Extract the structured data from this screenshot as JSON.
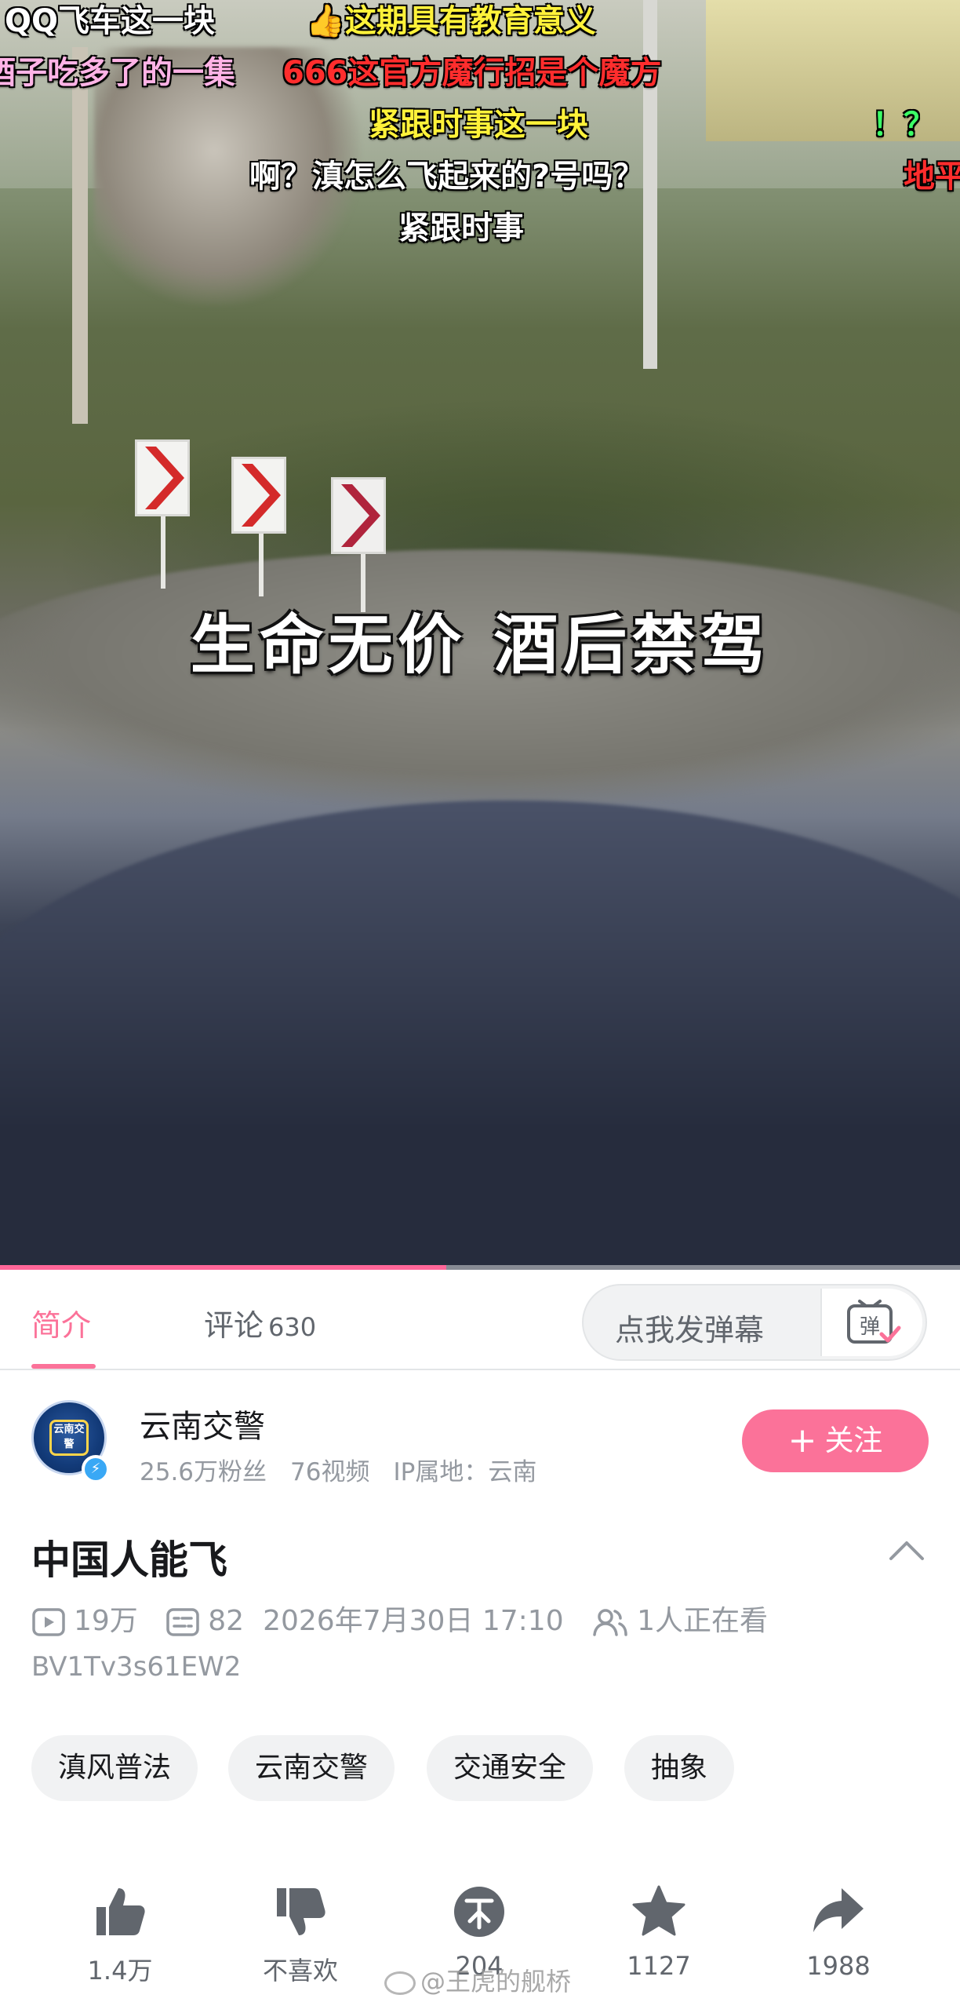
{
  "danmaku": [
    {
      "text": "QQ飞车这一块",
      "color": "white"
    },
    {
      "text": "这期具有教育意义",
      "color": "yellow"
    },
    {
      "text": "酒子吃多了的一集",
      "color": "pink"
    },
    {
      "text": "666这官方魔行招是个魔方",
      "color": "red"
    },
    {
      "text": "紧跟时事这一块",
      "color": "yellow"
    },
    {
      "text": "！？",
      "color": "green"
    },
    {
      "text": "啊？滇怎么飞起来的?号吗？",
      "color": "white"
    },
    {
      "text": "地平",
      "color": "red"
    },
    {
      "text": "紧跟时事",
      "color": "white"
    }
  ],
  "video": {
    "subtitle": "生命无价 酒后禁驾",
    "progress": 0.465
  },
  "tabs": {
    "intro": "简介",
    "comments": "评论",
    "comments_count": "630"
  },
  "danmaku_input": {
    "placeholder": "点我发弹幕",
    "toggle_label": "弹"
  },
  "uploader": {
    "name": "云南交警",
    "followers": "25.6万粉丝",
    "videos": "76视频",
    "ip_location": "IP属地：云南",
    "avatar_text": "云南交警",
    "follow_label": "关注"
  },
  "video_info": {
    "title": "中国人能飞",
    "views": "19万",
    "danmaku_count": "82",
    "publish_time": "2026年7月30日 17:10",
    "watching": "1人正在看",
    "bvid": "BV1Tv3s61EW2"
  },
  "tags": [
    "滇风普法",
    "云南交警",
    "交通安全",
    "抽象"
  ],
  "actions": {
    "like": "1.4万",
    "dislike": "不喜欢",
    "coin": "204",
    "favorite": "1127",
    "share": "1988"
  },
  "watermark": "@王虎的舰桥",
  "colors": {
    "accent": "#fb7299",
    "text_secondary": "#9499a0",
    "chip_bg": "#f1f2f3"
  },
  "icons": [
    "play-count-icon",
    "danmaku-count-icon",
    "watching-icon",
    "like-icon",
    "dislike-icon",
    "coin-icon",
    "favorite-icon",
    "share-icon",
    "collapse-icon",
    "verified-icon"
  ]
}
